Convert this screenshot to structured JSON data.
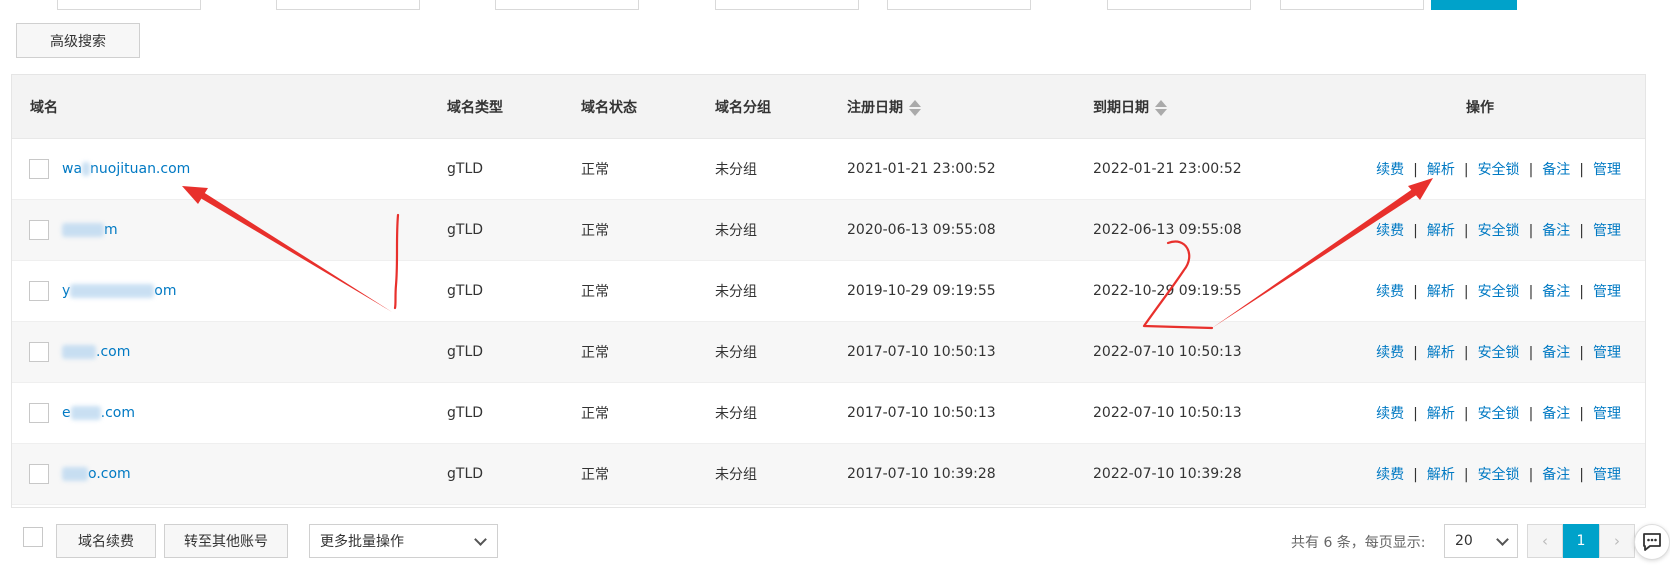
{
  "toolbar": {
    "advanced_search_label": "高级搜索"
  },
  "table": {
    "headers": {
      "name": "域名",
      "type": "域名类型",
      "status": "域名状态",
      "group": "域名分组",
      "reg_date": "注册日期",
      "exp_date": "到期日期",
      "ops": "操作"
    },
    "rows": [
      {
        "name_visible": "wa",
        "name_tail": "nuojituan.com",
        "type": "gTLD",
        "status": "正常",
        "group": "未分组",
        "reg_date": "2021-01-21 23:00:52",
        "exp_date": "2022-01-21 23:00:52"
      },
      {
        "name_visible": "",
        "name_tail": "m",
        "type": "gTLD",
        "status": "正常",
        "group": "未分组",
        "reg_date": "2020-06-13 09:55:08",
        "exp_date": "2022-06-13 09:55:08"
      },
      {
        "name_visible": "y",
        "name_tail": "om",
        "type": "gTLD",
        "status": "正常",
        "group": "未分组",
        "reg_date": "2019-10-29 09:19:55",
        "exp_date": "2022-10-29 09:19:55"
      },
      {
        "name_visible": "",
        "name_tail": ".com",
        "type": "gTLD",
        "status": "正常",
        "group": "未分组",
        "reg_date": "2017-07-10 10:50:13",
        "exp_date": "2022-07-10 10:50:13"
      },
      {
        "name_visible": "e",
        "name_tail": ".com",
        "type": "gTLD",
        "status": "正常",
        "group": "未分组",
        "reg_date": "2017-07-10 10:50:13",
        "exp_date": "2022-07-10 10:50:13"
      },
      {
        "name_visible": "",
        "name_tail": "o.com",
        "type": "gTLD",
        "status": "正常",
        "group": "未分组",
        "reg_date": "2017-07-10 10:39:28",
        "exp_date": "2022-07-10 10:39:28"
      }
    ],
    "ops": {
      "renew": "续费",
      "resolve": "解析",
      "security_lock": "安全锁",
      "remark": "备注",
      "manage": "管理",
      "separator": "|"
    }
  },
  "footer": {
    "renew_button": "域名续费",
    "transfer_button": "转至其他账号",
    "batch_select": "更多批量操作",
    "total_text": "共有 6 条，每页显示:",
    "page_size": "20",
    "current_page": "1",
    "prev_glyph": "‹",
    "next_glyph": "›"
  },
  "annotations": {
    "marker_1": "1",
    "marker_2": "2",
    "color": "#e8302c"
  },
  "colors": {
    "link": "#0079c3",
    "accent": "#00a2ca",
    "header_bg": "#f3f3f3",
    "alt_row_bg": "#f7f7f7"
  }
}
